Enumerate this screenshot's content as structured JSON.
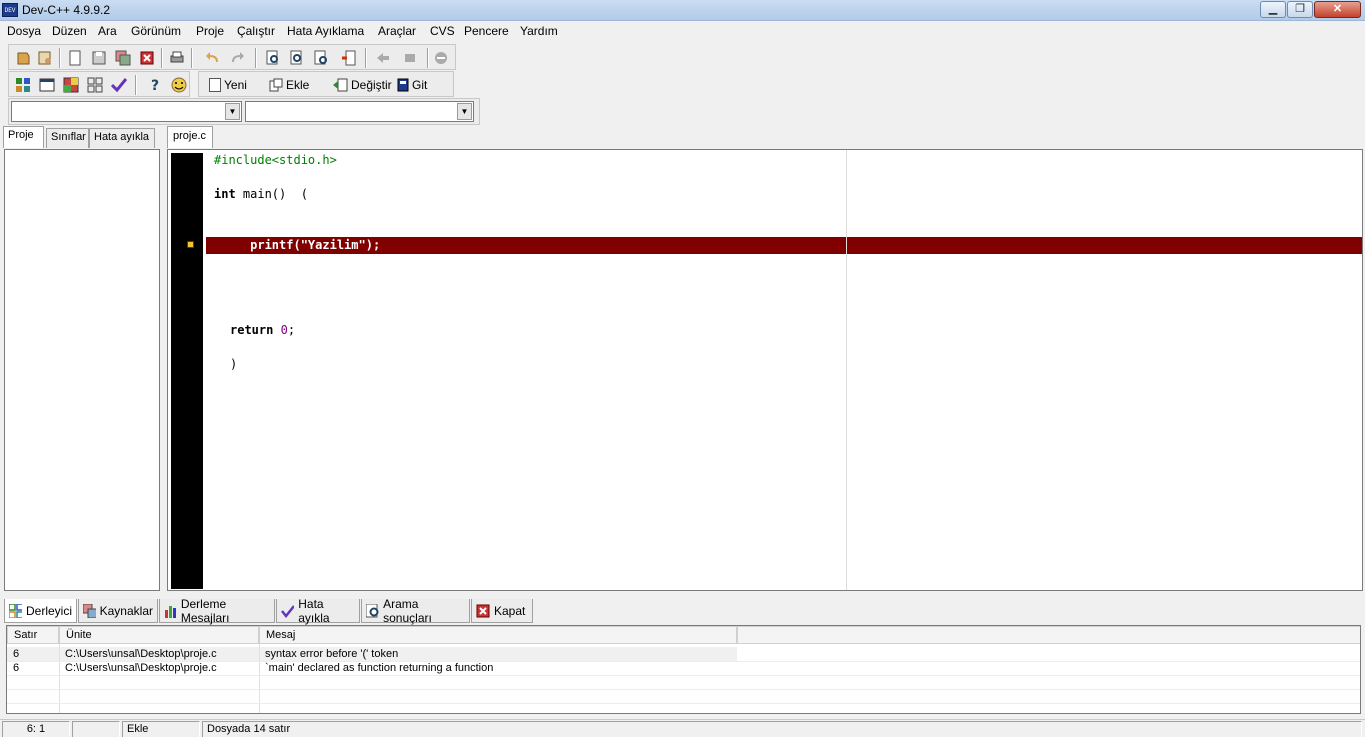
{
  "window": {
    "title": "Dev-C++ 4.9.9.2",
    "icon_text": "DEV"
  },
  "window_buttons": {
    "minimize": "▁",
    "maximize": "❐",
    "close": "✕"
  },
  "menu": [
    "Dosya",
    "Düzen",
    "Ara",
    "Görünüm",
    "Proje",
    "Çalıştır",
    "Hata Ayıklama",
    "Araçlar",
    "CVS",
    "Pencere",
    "Yardım"
  ],
  "toolbar2": {
    "new_label": "Yeni",
    "add_label": "Ekle",
    "change_label": "Değiştir",
    "goto_label": "Git"
  },
  "left_tabs": [
    "Proje",
    "Sınıflar",
    "Hata ayıkla"
  ],
  "editor": {
    "tab": "proje.c",
    "lines": {
      "l1": "#include<stdio.h>",
      "l3a": "int",
      "l3b": " main()  (",
      "l6": "     printf(\"Yazilim\");",
      "l11a": "return",
      "l11b": " 0",
      "l11c": ";",
      "l13": ")"
    }
  },
  "bottom_tabs": [
    "Derleyici",
    "Kaynaklar",
    "Derleme Mesajları",
    "Hata ayıkla",
    "Arama sonuçları",
    "Kapat"
  ],
  "results": {
    "columns": [
      "Satır",
      "Ünite",
      "Mesaj"
    ],
    "rows": [
      {
        "line": "6",
        "unit": "C:\\Users\\unsal\\Desktop\\proje.c",
        "message": "syntax error before '(' token"
      },
      {
        "line": "6",
        "unit": "C:\\Users\\unsal\\Desktop\\proje.c",
        "message": "`main' declared as function returning a function"
      }
    ]
  },
  "status": {
    "position": "6: 1",
    "mode": "Ekle",
    "info": "Dosyada 14 satır"
  },
  "colors": {
    "error_line": "#800000",
    "preprocessor": "#008000",
    "number": "#800080",
    "gutter": "#000000"
  }
}
